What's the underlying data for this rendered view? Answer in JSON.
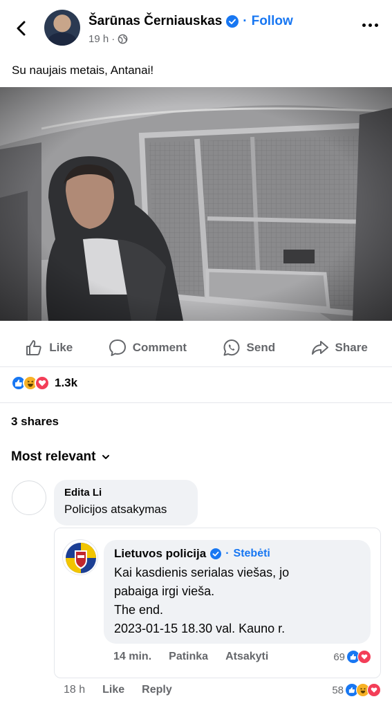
{
  "header": {
    "author": "Šarūnas Černiauskas",
    "follow_separator": "·",
    "follow_label": "Follow",
    "time": "19 h",
    "time_separator": "·",
    "privacy_icon": "globe-icon"
  },
  "post": {
    "text": "Su naujais metais, Antanai!",
    "photo_icon": "photo-cctv-cell"
  },
  "actions": {
    "like": "Like",
    "comment": "Comment",
    "send": "Send",
    "share": "Share"
  },
  "reactions": {
    "icons": [
      "like-icon",
      "haha-icon",
      "love-icon"
    ],
    "count": "1.3k"
  },
  "shares": "3 shares",
  "sort_label": "Most relevant",
  "comment": {
    "author": "Edita Li",
    "text": "Policijos atsakymas",
    "time": "18 h",
    "like_label": "Like",
    "reply_label": "Reply",
    "reaction_count": "58"
  },
  "reply": {
    "author": "Lietuvos policija",
    "follow_separator": "·",
    "follow_label": "Stebėti",
    "lines": [
      "Kai kasdienis serialas viešas, jo",
      "pabaiga irgi vieša.",
      "The end.",
      "2023-01-15 18.30 val. Kauno r."
    ],
    "time": "14 min.",
    "like_label": "Patinka",
    "reply_label": "Atsakyti",
    "reaction_count": "69"
  },
  "colors": {
    "accent": "#1877f2",
    "secondary_text": "#65676b",
    "bubble": "#f0f2f5",
    "love": "#f33e58",
    "haha": "#f7b125"
  }
}
